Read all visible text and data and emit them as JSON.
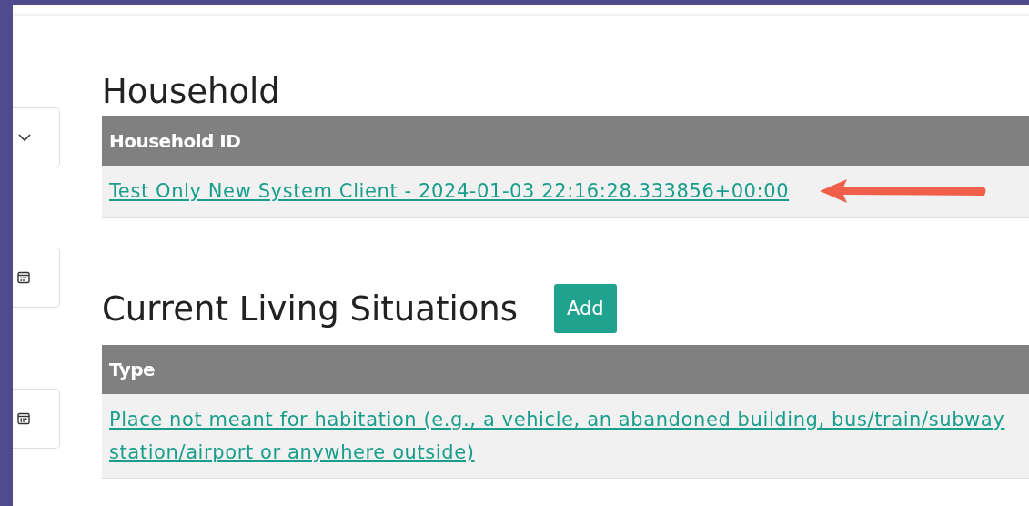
{
  "side_controls": [
    {
      "kind": "select"
    },
    {
      "kind": "date"
    },
    {
      "kind": "date"
    }
  ],
  "sections": [
    {
      "title": "Household",
      "columns": [
        "Household ID"
      ],
      "rows": [
        [
          "Test Only New System Client - 2024-01-03 22:16:28.333856+00:00"
        ]
      ],
      "annotated": true
    },
    {
      "title": "Current Living Situations",
      "button": "Add",
      "columns": [
        "Type"
      ],
      "rows": [
        [
          "Place not meant for habitation (e.g., a vehicle, an abandoned building, bus/train/subway station/airport or anywhere outside)"
        ]
      ],
      "annotated": false
    }
  ]
}
